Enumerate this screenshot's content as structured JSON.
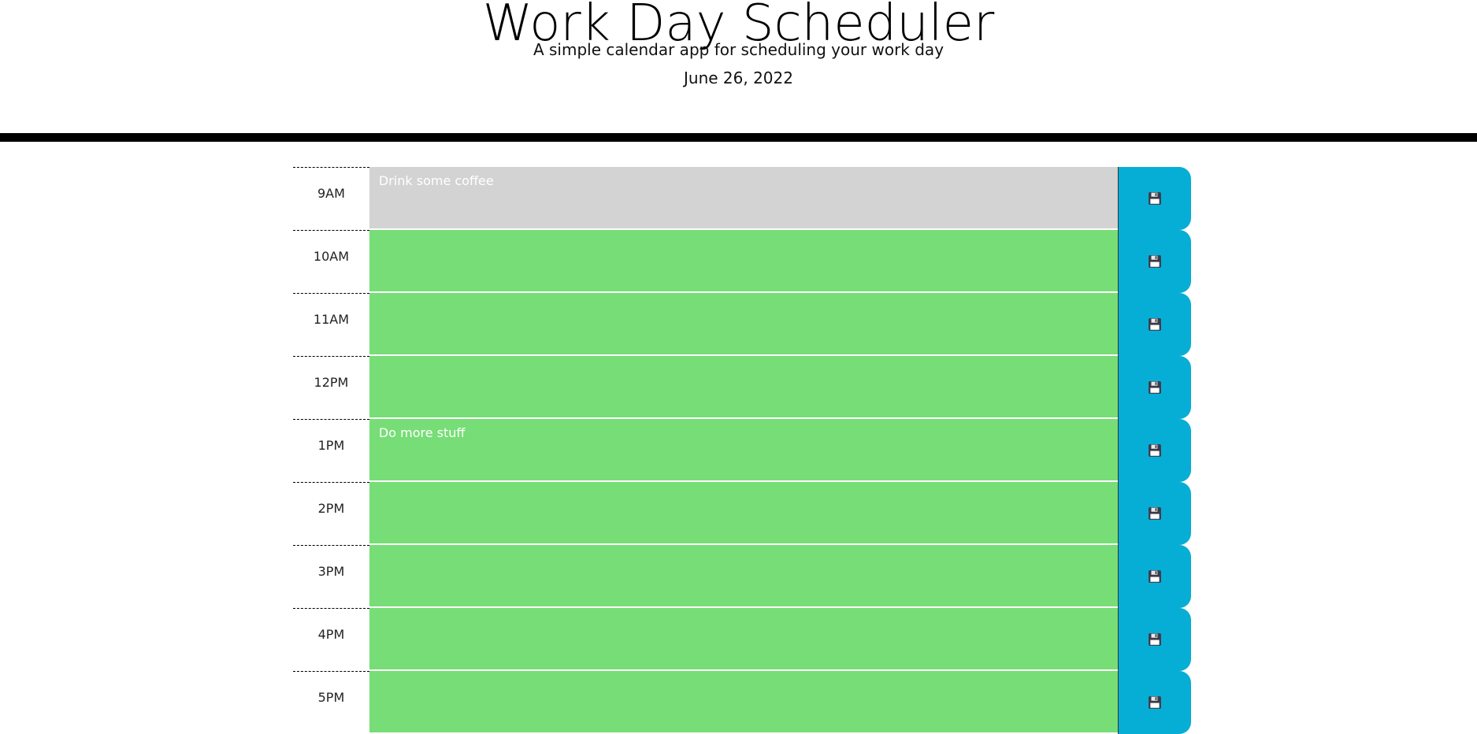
{
  "header": {
    "title": "Work Day Scheduler",
    "subtitle": "A simple calendar app for scheduling your work day",
    "current_day": "June 26, 2022"
  },
  "colors": {
    "past": "#d3d3d3",
    "future": "#77dd77",
    "save_button": "#06aed5"
  },
  "time_blocks": [
    {
      "hour": "9AM",
      "description": "Drink some coffee",
      "state": "past",
      "save_icon": "floppy-disk-icon"
    },
    {
      "hour": "10AM",
      "description": "",
      "state": "future",
      "save_icon": "floppy-disk-icon"
    },
    {
      "hour": "11AM",
      "description": "",
      "state": "future",
      "save_icon": "floppy-disk-icon"
    },
    {
      "hour": "12PM",
      "description": "",
      "state": "future",
      "save_icon": "floppy-disk-icon"
    },
    {
      "hour": "1PM",
      "description": "Do more stuff",
      "state": "future",
      "save_icon": "floppy-disk-icon"
    },
    {
      "hour": "2PM",
      "description": "",
      "state": "future",
      "save_icon": "floppy-disk-icon"
    },
    {
      "hour": "3PM",
      "description": "",
      "state": "future",
      "save_icon": "floppy-disk-icon"
    },
    {
      "hour": "4PM",
      "description": "",
      "state": "future",
      "save_icon": "floppy-disk-icon"
    },
    {
      "hour": "5PM",
      "description": "",
      "state": "future",
      "save_icon": "floppy-disk-icon"
    }
  ]
}
